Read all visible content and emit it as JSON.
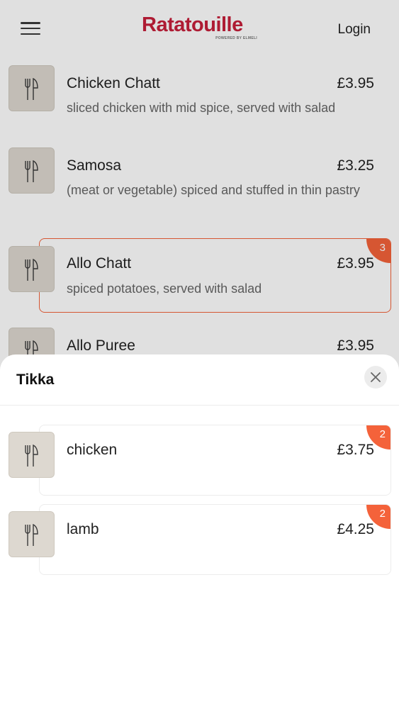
{
  "header": {
    "brand": "Ratatouille",
    "brand_sub": "POWERED BY ELMELI",
    "login_label": "Login",
    "brand_color": "#c61f3b"
  },
  "menu_items": [
    {
      "name": "Chicken Chatt",
      "price": "£3.95",
      "description": "sliced chicken with mid spice, served with salad",
      "icon": "cutlery-icon"
    },
    {
      "name": "Samosa",
      "price": "£3.25",
      "description": "(meat or vegetable) spiced and stuffed in thin pastry",
      "icon": "cutlery-icon"
    },
    {
      "name": "Allo Chatt",
      "price": "£3.95",
      "description": "spiced potatoes, served with salad",
      "icon": "cutlery-icon",
      "selected_count": "3"
    },
    {
      "name": "Allo Puree",
      "price": "£3.95",
      "description": "",
      "icon": "cutlery-icon"
    }
  ],
  "sheet": {
    "title": "Tikka",
    "close_icon": "close-icon",
    "options": [
      {
        "name": "chicken",
        "price": "£3.75",
        "count": "2",
        "icon": "cutlery-icon"
      },
      {
        "name": "lamb",
        "price": "£4.25",
        "count": "2",
        "icon": "cutlery-icon"
      }
    ]
  },
  "colors": {
    "accent": "#f4623a",
    "thumb_bg": "#ddd8d0"
  }
}
